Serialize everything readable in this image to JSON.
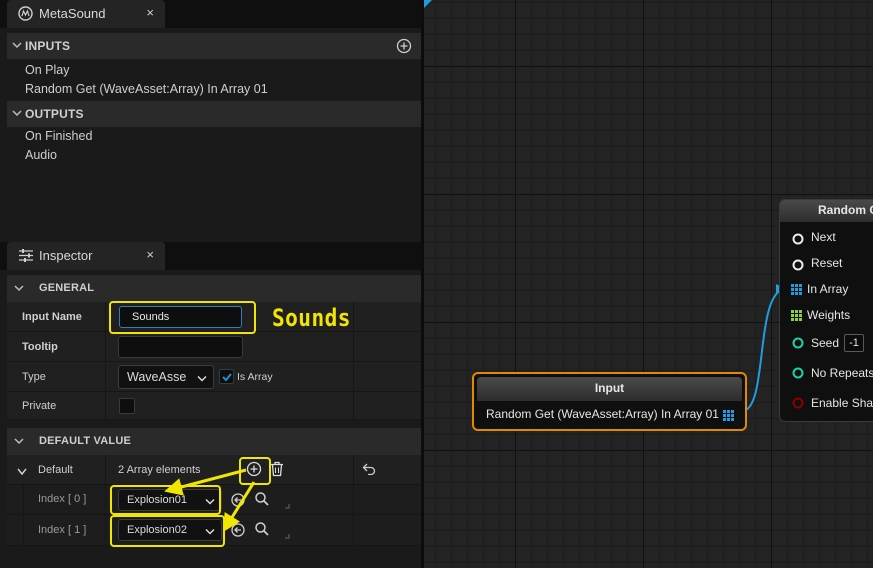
{
  "metasound_tab": {
    "title": "MetaSound",
    "close": "×"
  },
  "inputs": {
    "header": "INPUTS",
    "items": [
      "On Play",
      "Random Get (WaveAsset:Array) In Array 01"
    ]
  },
  "outputs": {
    "header": "OUTPUTS",
    "items": [
      "On Finished",
      "Audio"
    ]
  },
  "inspector_tab": {
    "title": "Inspector",
    "close": "×"
  },
  "general": {
    "header": "GENERAL",
    "input_name_label": "Input Name",
    "input_name_value": "Sounds",
    "tooltip_label": "Tooltip",
    "tooltip_value": "",
    "type_label": "Type",
    "type_value": "WaveAsse",
    "is_array_label": "Is Array",
    "private_label": "Private"
  },
  "default_value": {
    "header": "DEFAULT VALUE",
    "default_label": "Default",
    "elements_text": "2 Array elements",
    "entries": [
      {
        "index_label": "Index [ 0 ]",
        "value": "Explosion01"
      },
      {
        "index_label": "Index [ 1 ]",
        "value": "Explosion02"
      }
    ]
  },
  "annotation": {
    "text": "Sounds"
  },
  "input_node": {
    "title": "Input",
    "pin_label": "Random Get (WaveAsset:Array) In Array 01"
  },
  "random_node": {
    "title": "Random G",
    "pins": [
      "Next",
      "Reset",
      "In Array",
      "Weights",
      "Seed",
      "No Repeats",
      "Enable Shar"
    ],
    "seed_value": "-1"
  },
  "colors": {
    "highlight": "#f2e600",
    "node_outline": "#e08a00",
    "wire": "#1e9ee0",
    "check": "#1c8fd6"
  }
}
